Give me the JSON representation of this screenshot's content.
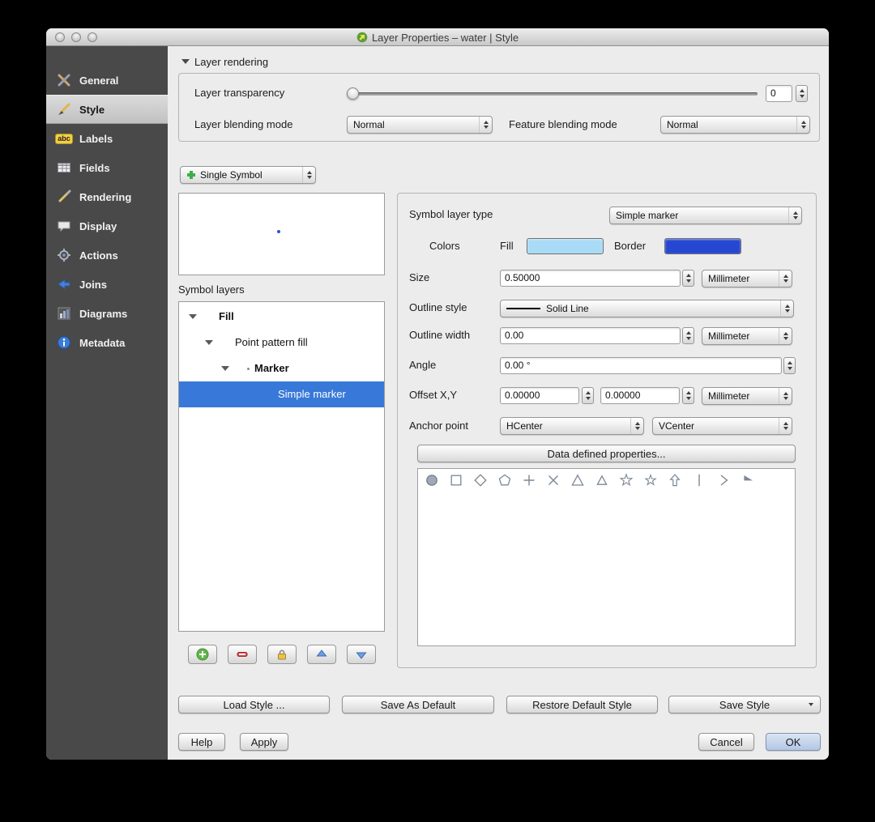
{
  "window": {
    "title": "Layer Properties – water | Style"
  },
  "sidebar": {
    "selected": "Style",
    "items": [
      {
        "label": "General",
        "icon": "tools-icon"
      },
      {
        "label": "Style",
        "icon": "paintbrush-icon"
      },
      {
        "label": "Labels",
        "icon": "abc-badge-icon",
        "icon_text": "abc"
      },
      {
        "label": "Fields",
        "icon": "table-icon"
      },
      {
        "label": "Rendering",
        "icon": "render-brush-icon"
      },
      {
        "label": "Display",
        "icon": "speech-bubble-icon"
      },
      {
        "label": "Actions",
        "icon": "gear-icon"
      },
      {
        "label": "Joins",
        "icon": "join-arrow-icon"
      },
      {
        "label": "Diagrams",
        "icon": "bar-chart-icon"
      },
      {
        "label": "Metadata",
        "icon": "info-icon"
      }
    ]
  },
  "layer_rendering": {
    "section_title": "Layer rendering",
    "transparency_label": "Layer transparency",
    "transparency_value": "0",
    "blending_label": "Layer blending mode",
    "blending_value": "Normal",
    "feature_blending_label": "Feature blending mode",
    "feature_blending_value": "Normal"
  },
  "symbol": {
    "renderer_value": "Single Symbol",
    "symbol_layers_label": "Symbol layers",
    "tree": [
      {
        "label": "Fill",
        "level": 0
      },
      {
        "label": "Point pattern fill",
        "level": 1
      },
      {
        "label": "Marker",
        "level": 2
      },
      {
        "label": "Simple marker",
        "level": 3,
        "selected": true
      }
    ]
  },
  "properties": {
    "symbol_layer_type_label": "Symbol layer type",
    "symbol_layer_type_value": "Simple marker",
    "colors_label": "Colors",
    "fill_label": "Fill",
    "fill_color": "#a9dbf6",
    "border_label": "Border",
    "border_color": "#2547d2",
    "size_label": "Size",
    "size_value": "0.50000",
    "size_unit": "Millimeter",
    "outline_style_label": "Outline style",
    "outline_style_value": "Solid Line",
    "outline_width_label": "Outline width",
    "outline_width_value": "0.00",
    "outline_width_unit": "Millimeter",
    "angle_label": "Angle",
    "angle_value": "0.00 °",
    "offset_label": "Offset X,Y",
    "offset_x_value": "0.00000",
    "offset_y_value": "0.00000",
    "offset_unit": "Millimeter",
    "anchor_label": "Anchor point",
    "anchor_h_value": "HCenter",
    "anchor_v_value": "VCenter",
    "data_defined_button": "Data defined properties...",
    "marker_shapes": [
      "circle",
      "square",
      "diamond",
      "pentagon",
      "cross",
      "cross2",
      "triangle",
      "equilateral-triangle",
      "star",
      "regular-star",
      "arrow",
      "line",
      "chevron",
      "half-arrowhead"
    ]
  },
  "footer": {
    "load_style": "Load Style ...",
    "save_as_default": "Save As Default",
    "restore_default": "Restore Default Style",
    "save_style": "Save Style",
    "help": "Help",
    "apply": "Apply",
    "cancel": "Cancel",
    "ok": "OK"
  },
  "colors": {
    "selection_blue": "#3878d8",
    "sidebar_bg": "#494949",
    "window_bg": "#ececec"
  }
}
